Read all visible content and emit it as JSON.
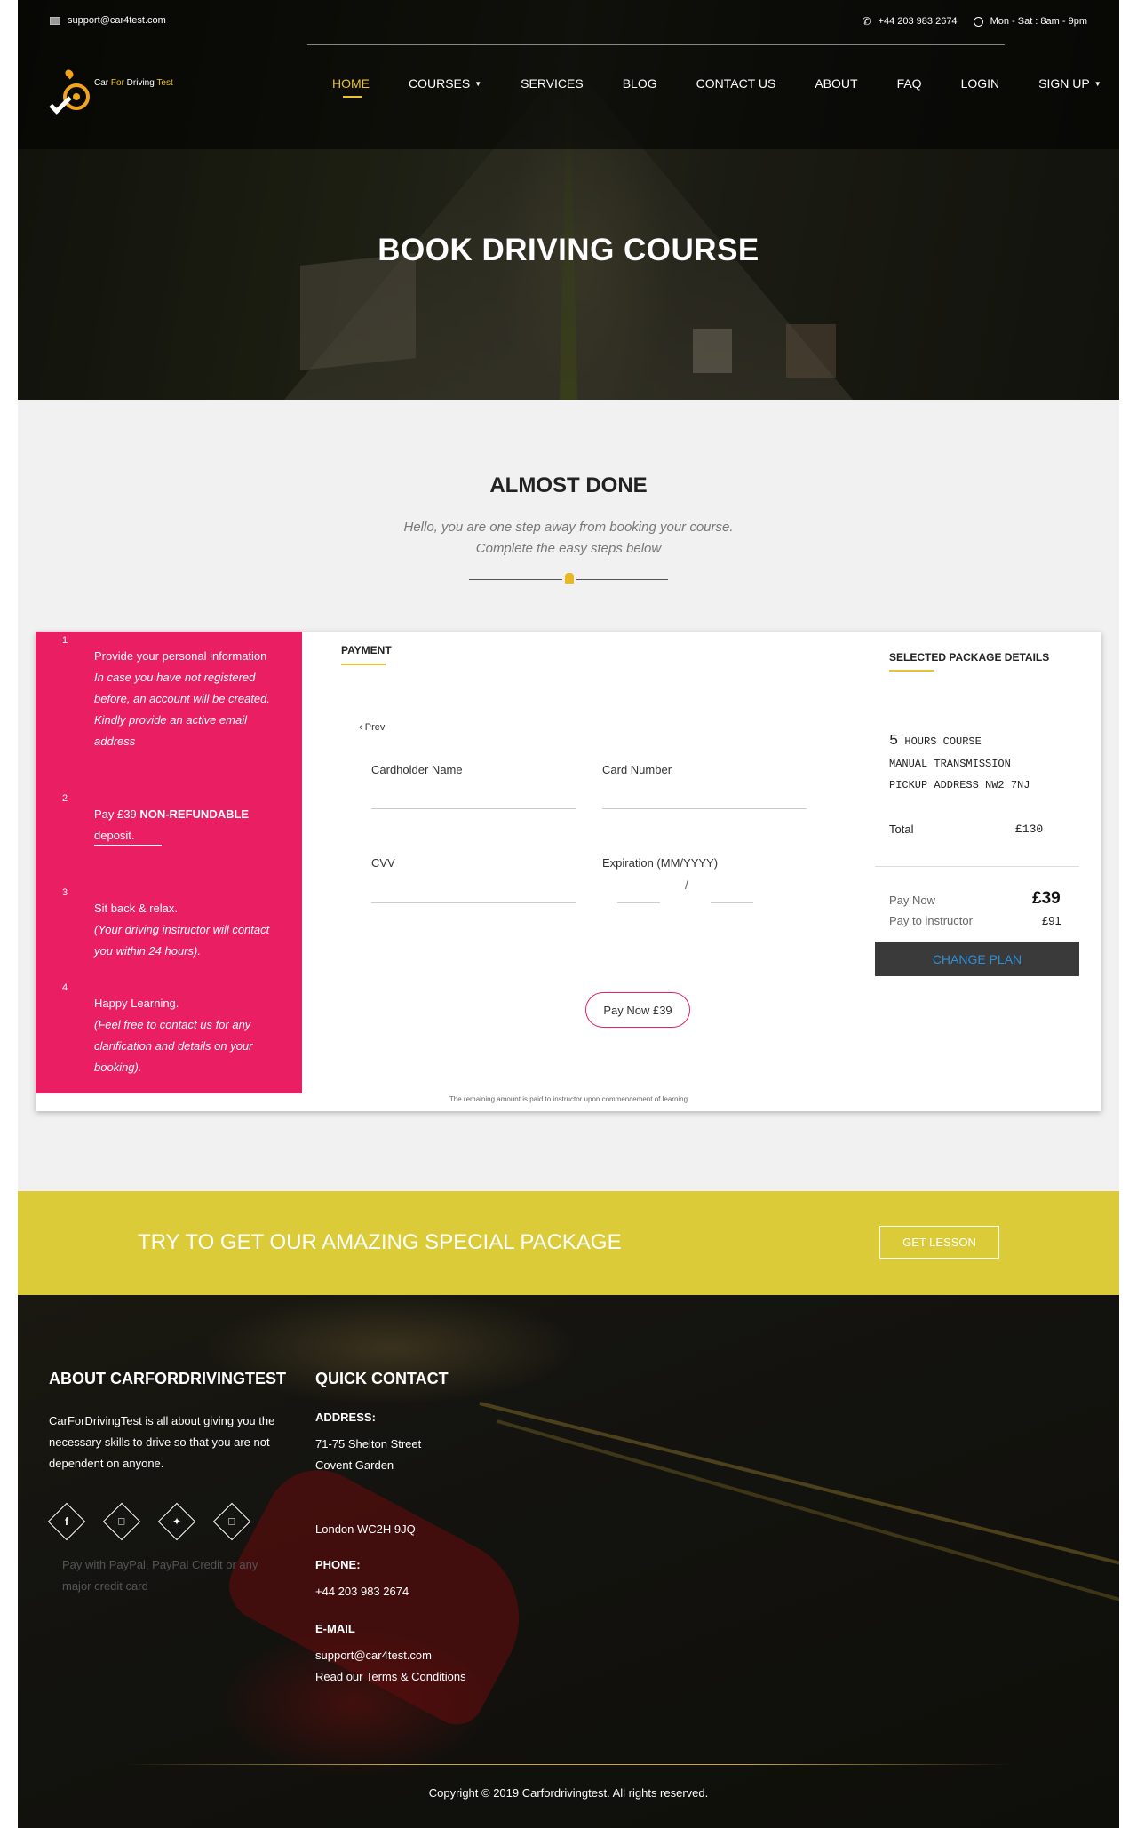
{
  "topbar": {
    "email": "support@car4test.com",
    "phone": "+44 203 983 2674",
    "hours": "Mon - Sat : 8am - 9pm"
  },
  "logo": {
    "part1": "Car ",
    "part2": "For",
    "part3": " Driving ",
    "part4": "Test"
  },
  "nav": {
    "home": "HOME",
    "courses": "COURSES",
    "services": "SERVICES",
    "blog": "BLOG",
    "contact": "CONTACT US",
    "about": "ABOUT",
    "faq": "FAQ",
    "login": "LOGIN",
    "signup": "SIGN UP"
  },
  "hero": {
    "title": "BOOK DRIVING COURSE"
  },
  "intro": {
    "title": "ALMOST DONE",
    "line1": "Hello, you are one step away from booking your course.",
    "line2": "Complete the easy steps below"
  },
  "steps": [
    {
      "num": "1",
      "text": "Provide your personal information",
      "note": "In case you have not registered before, an account will be created. Kindly provide an active email address"
    },
    {
      "num": "2",
      "text_pre": "Pay £39 ",
      "text_bold": "NON-REFUNDABLE",
      "text_post": "deposit."
    },
    {
      "num": "3",
      "text": "Sit back & relax.",
      "note": "(Your driving instructor will contact you within 24 hours)."
    },
    {
      "num": "4",
      "text": "Happy Learning.",
      "note": "(Feel free to contact us for any clarification and details on your booking)."
    }
  ],
  "payment": {
    "title": "PAYMENT",
    "prev": "Prev",
    "cardholder_label": "Cardholder Name",
    "card_number_label": "Card Number",
    "cvv_label": "CVV",
    "expiration_label": "Expiration (MM/YYYY)",
    "expiration_sep": "/",
    "pay_button": "Pay Now £39",
    "footnote": "The remaining amount is paid to instructor upon commencement of learning"
  },
  "package": {
    "title": "SELECTED PACKAGE DETAILS",
    "hours": "5",
    "hours_suffix": " HOURS COURSE",
    "transmission": "MANUAL TRANSMISSION",
    "pickup": "PICKUP ADDRESS NW2 7NJ",
    "total_label": "Total",
    "total_value": "£130",
    "pay_now_label": "Pay Now",
    "pay_now_value": "£39",
    "pay_instructor_label": "Pay to instructor",
    "pay_instructor_value": "£91",
    "change_plan": "CHANGE PLAN"
  },
  "banner": {
    "text": "TRY TO GET OUR AMAZING SPECIAL PACKAGE",
    "button": "GET LESSON"
  },
  "footer": {
    "about_title": "ABOUT CARFORDRIVINGTEST",
    "about_text": "CarForDrivingTest is all about giving you the necessary skills to drive so that you are not dependent on anyone.",
    "paypal_alt": "Pay with PayPal, PayPal Credit or any major credit card",
    "contact_title": "QUICK CONTACT",
    "address_label": "ADDRESS:",
    "address_line1": "71-75 Shelton Street",
    "address_line2": "Covent Garden",
    "address_line3": "London WC2H 9JQ",
    "phone_label": "PHONE:",
    "phone": "+44 203 983 2674",
    "email_label": "E-MAIL",
    "email": "support@car4test.com",
    "terms": "Read our Terms & Conditions",
    "copyright": "Copyright © 2019 Carfordrivingtest. All rights reserved."
  },
  "colors": {
    "accent": "#e8c230",
    "steps_bg": "#e91e63",
    "banner_bg": "#dccb38",
    "change_plan_text": "#2d8fd9"
  },
  "icons": [
    "mail-icon",
    "phone-icon",
    "clock-icon",
    "chevron-down-icon",
    "chevron-left-icon",
    "facebook-icon",
    "instagram-icon",
    "twitter-icon",
    "linkedin-icon"
  ]
}
